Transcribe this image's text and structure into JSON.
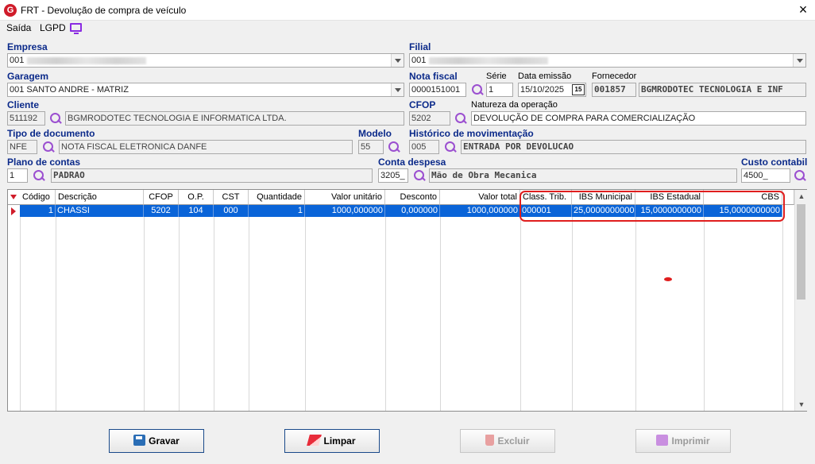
{
  "window": {
    "title": "FRT - Devolução de compra de veículo",
    "logo_letter": "G"
  },
  "menu": {
    "items": [
      "Saída",
      "LGPD"
    ]
  },
  "form": {
    "empresa": {
      "label": "Empresa",
      "value": "001"
    },
    "filial": {
      "label": "Filial",
      "value": "001"
    },
    "garagem": {
      "label": "Garagem",
      "value": "001 SANTO ANDRE - MATRIZ"
    },
    "nota_fiscal": {
      "label": "Nota fiscal",
      "value": "0000151001"
    },
    "serie": {
      "label": "Série",
      "value": "1"
    },
    "data_emissao": {
      "label": "Data emissão",
      "value": "15/10/2025",
      "calendar_icon": "15"
    },
    "fornecedor": {
      "label": "Fornecedor",
      "code": "001857",
      "name": "BGMRODOTEC TECNOLOGIA E INF"
    },
    "cliente": {
      "label": "Cliente",
      "code": "511192",
      "name": "BGMRODOTEC TECNOLOGIA E INFORMATICA LTDA."
    },
    "cfop": {
      "label": "CFOP",
      "value": "5202"
    },
    "natureza": {
      "label": "Natureza da operação",
      "value": "DEVOLUÇÃO DE COMPRA PARA COMERCIALIZAÇÃO"
    },
    "tipo_documento": {
      "label": "Tipo de documento",
      "code": "NFE",
      "name": "NOTA FISCAL ELETRONICA DANFE"
    },
    "modelo": {
      "label": "Modelo",
      "value": "55"
    },
    "historico": {
      "label": "Histórico de movimentação",
      "code": "005",
      "name": "ENTRADA POR DEVOLUCAO"
    },
    "plano_contas": {
      "label": "Plano de contas",
      "code": "1",
      "name": "PADRAO"
    },
    "conta_despesa": {
      "label": "Conta despesa",
      "code": "3205_",
      "name": "Mão de Obra Mecanica"
    },
    "custo_contabil": {
      "label": "Custo contabil",
      "value": "4500_"
    }
  },
  "grid": {
    "headers": [
      "Código",
      "Descrição",
      "CFOP",
      "O.P.",
      "CST",
      "Quantidade",
      "Valor unitário",
      "Desconto",
      "Valor total",
      "Class. Trib.",
      "IBS Municipal",
      "IBS Estadual",
      "CBS"
    ],
    "rows": [
      [
        "1",
        "CHASSI",
        "5202",
        "104",
        "000",
        "1",
        "1000,000000",
        "0,000000",
        "1000,000000",
        "000001",
        "25,0000000000",
        "15,0000000000",
        "15,0000000000"
      ]
    ]
  },
  "buttons": {
    "gravar": "Gravar",
    "limpar": "Limpar",
    "excluir": "Excluir",
    "imprimir": "Imprimir"
  },
  "colors": {
    "label_blue": "#0b2a8a",
    "selection": "#0a64d8",
    "highlight_red": "#e01e1e",
    "icon_purple": "#9b4fd0"
  },
  "icons": [
    "app-logo-icon",
    "close-icon",
    "monitor-icon",
    "search-icon",
    "calendar-icon",
    "save-icon",
    "eraser-icon",
    "trash-icon",
    "printer-icon"
  ]
}
